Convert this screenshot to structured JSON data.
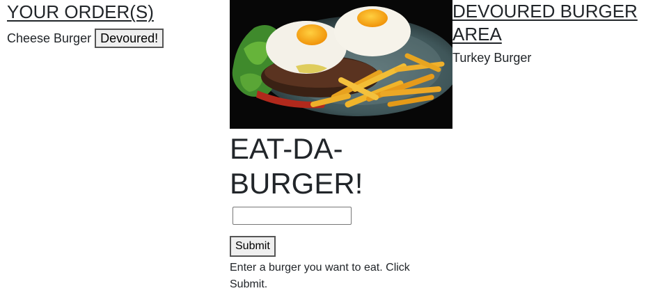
{
  "orders": {
    "heading": "YOUR ORDER(S)",
    "items": [
      {
        "name": "Cheese Burger",
        "button_label": "Devoured!"
      }
    ]
  },
  "main": {
    "image_alt": "Burger with fried eggs and fries",
    "title": "EAT-DA-BURGER!",
    "input_value": "",
    "input_placeholder": "",
    "submit_label": "Submit",
    "instructions": "Enter a burger you want to eat. Click Submit."
  },
  "devoured": {
    "heading": "DEVOURED BURGER AREA",
    "items": [
      {
        "name": "Turkey Burger"
      }
    ]
  }
}
